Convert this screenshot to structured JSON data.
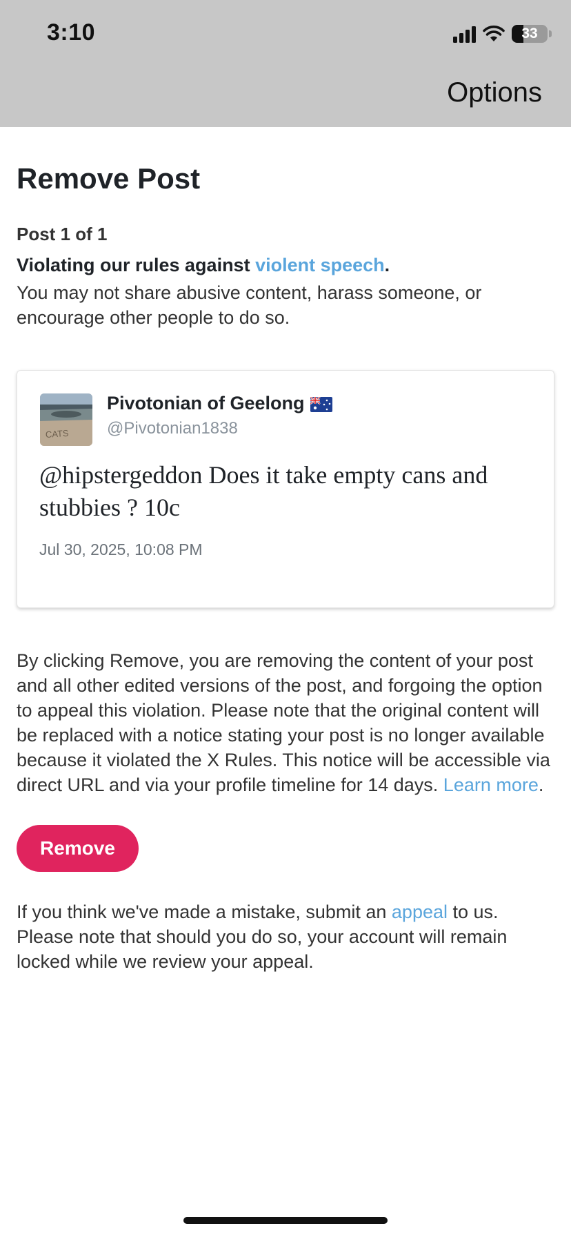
{
  "status_bar": {
    "time": "3:10",
    "battery": "33"
  },
  "header": {
    "options_label": "Options"
  },
  "page": {
    "title": "Remove Post",
    "post_count": "Post 1 of 1",
    "violation_prefix": "Violating our rules against ",
    "violation_link": "violent speech",
    "violation_suffix": ".",
    "rule_description": "You may not share abusive content, harass someone, or encourage other people to do so."
  },
  "post": {
    "author_name": "Pivotonian of Geelong",
    "author_flag": "australia-flag-icon",
    "avatar_caption": "CATS",
    "handle": "@Pivotonian1838",
    "text": "@hipstergeddon Does it take empty cans and stubbies ? 10c",
    "date": "Jul 30, 2025, 10:08 PM"
  },
  "explanation": {
    "text": "By clicking Remove, you are removing the content of your post and all other edited versions of the post, and forgoing the option to appeal this violation. Please note that the original content will be replaced with a notice stating your post is no longer available because it violated the X Rules. This notice will be accessible via direct URL and via your profile timeline for 14 days. ",
    "link": "Learn more",
    "suffix": "."
  },
  "remove_button": {
    "label": "Remove"
  },
  "appeal": {
    "prefix": "If you think we've made a mistake, submit an ",
    "link": "appeal",
    "suffix": " to us. Please note that should you do so, your account will remain locked while we review your appeal."
  },
  "colors": {
    "link": "#5aa5dc",
    "remove_button": "#e0245e",
    "header_bg": "#c7c7c7"
  }
}
